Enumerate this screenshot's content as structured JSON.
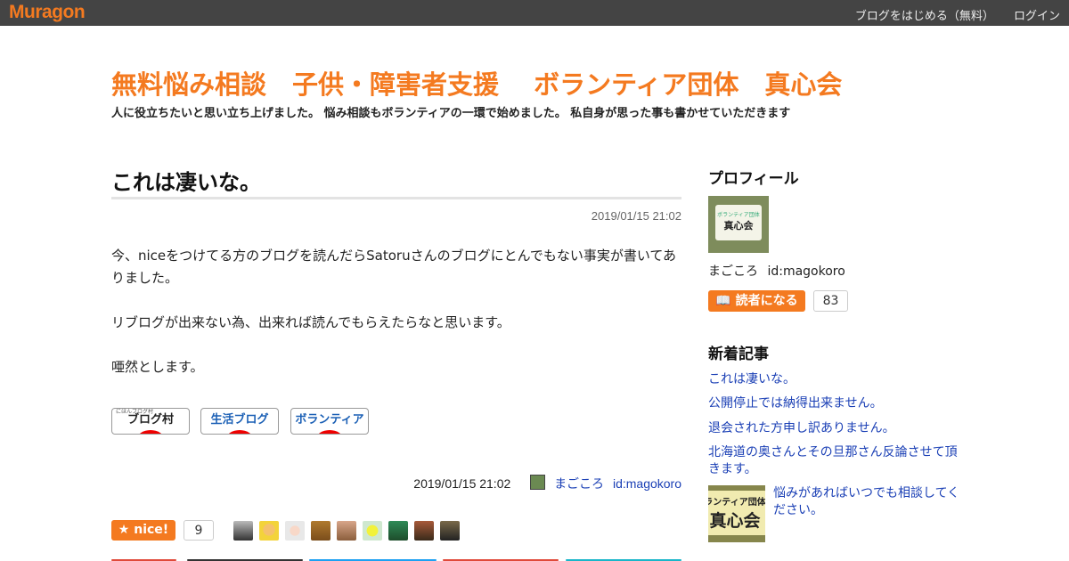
{
  "topbar": {
    "logo": "Muragon",
    "links": [
      "ブログをはじめる（無料）",
      "ログイン"
    ]
  },
  "blog": {
    "title": "無料悩み相談　子供・障害者支援　 ボランティア団体　真心会",
    "description": "人に役立ちたいと思い立ち上げました。 悩み相談もボランティアの一環で始めました。 私自身が思った事も書かせていただきます"
  },
  "post": {
    "title": "これは凄いな。",
    "date": "2019/01/15 21:02",
    "paragraphs": [
      "今、niceをつけてる方のブログを読んだらSatoruさんのブログにとんでもない事実が書いてありました。",
      "リブログが出来ない為、出来れば読んでもらえたらなと思います。",
      "唖然とします。"
    ],
    "banners": [
      {
        "label": "ブログ村",
        "small": "にほんブログ村",
        "color": "#222"
      },
      {
        "label": "生活ブログ",
        "color": "#1a5fb5",
        "accent": "#f47a20"
      },
      {
        "label": "ボランティア",
        "color": "#1a5fb5"
      }
    ],
    "footer": {
      "date": "2019/01/15 21:02",
      "author": "まごころ",
      "author_id": "id:magokoro"
    },
    "nice": {
      "label": "nice!",
      "count": "9"
    }
  },
  "sidebar": {
    "profile_heading": "プロフィール",
    "profile_image_text": "真心会",
    "profile_image_small": "ボランティア団体",
    "profile_name": "まごころ",
    "profile_id": "id:magokoro",
    "reader_button": "読者になる",
    "reader_count": "83",
    "recent_heading": "新着記事",
    "recent": [
      "これは凄いな。",
      "公開停止では納得出来ません。",
      "退会された方申し訳ありません。",
      "北海道の奥さんとその旦那さん反論させて頂きます。",
      "悩みがあればいつでも相談してください。"
    ],
    "recent_thumb_text": "真心会",
    "recent_thumb_small": "ランティア団体"
  },
  "colors": {
    "accent": "#f47a20",
    "link": "#1a3fb5",
    "topbar": "#444444"
  }
}
